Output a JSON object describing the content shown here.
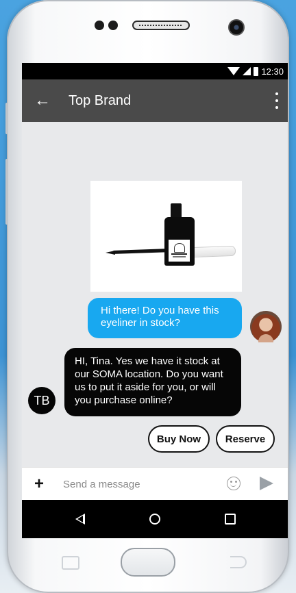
{
  "status_bar": {
    "time": "12:30"
  },
  "app_bar": {
    "back_glyph": "←",
    "title": "Top Brand"
  },
  "messages": {
    "outgoing": "Hi there! Do you have this eyeliner in stock?",
    "incoming": "HI, Tina. Yes we have it stock at our SOMA location. Do you want us to put it aside for you, or will you purchase online?",
    "sender_initials": "TB"
  },
  "quick_replies": {
    "buy_now": "Buy Now",
    "reserve": "Reserve"
  },
  "composer": {
    "add_glyph": "+",
    "placeholder": "Send a message"
  },
  "colors": {
    "accent": "#18A8F0",
    "app_bar": "#4A4A4A",
    "incoming_bubble": "#060606"
  },
  "icons": [
    "back-arrow-icon",
    "more-vert-icon",
    "emoji-icon",
    "send-icon",
    "nav-back-icon",
    "nav-home-icon",
    "nav-recent-icon",
    "signal-icon",
    "wifi-icon",
    "battery-icon"
  ]
}
